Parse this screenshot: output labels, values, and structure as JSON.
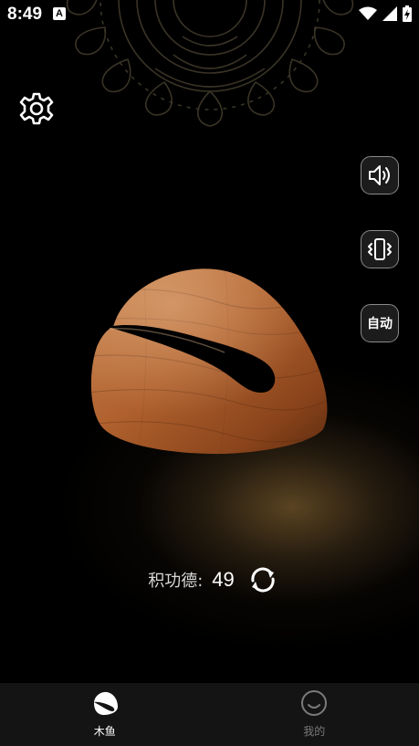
{
  "status_bar": {
    "time": "8:49",
    "app_icon": "A",
    "icons": [
      "wifi-icon",
      "signal-icon",
      "battery-charging-icon"
    ]
  },
  "controls": {
    "settings_icon": "gear-icon",
    "sound_icon": "speaker-icon",
    "vibrate_icon": "vibrate-icon",
    "auto_label": "自动"
  },
  "woodfish": {
    "icon": "wooden-fish"
  },
  "merit": {
    "label": "积功德:",
    "count": "49",
    "reset_icon": "refresh-icon"
  },
  "bottom_nav": {
    "tabs": [
      {
        "label": "木鱼",
        "icon": "woodfish-icon",
        "active": true
      },
      {
        "label": "我的",
        "icon": "smile-icon",
        "active": false
      }
    ]
  },
  "colors": {
    "background": "#000000",
    "glow": "#6b5030",
    "wood_light": "#c27a45",
    "wood_dark": "#6e3516",
    "nav_bg": "#141414",
    "nav_inactive": "#7a7a7a",
    "button_border": "#8a8a8a"
  }
}
